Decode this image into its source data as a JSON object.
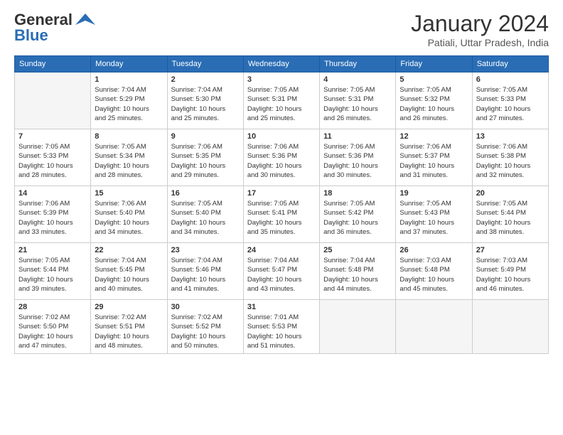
{
  "header": {
    "logo_general": "General",
    "logo_blue": "Blue",
    "month_title": "January 2024",
    "location": "Patiali, Uttar Pradesh, India"
  },
  "days_of_week": [
    "Sunday",
    "Monday",
    "Tuesday",
    "Wednesday",
    "Thursday",
    "Friday",
    "Saturday"
  ],
  "weeks": [
    [
      {
        "day": "",
        "empty": true
      },
      {
        "day": "1",
        "sunrise": "7:04 AM",
        "sunset": "5:29 PM",
        "daylight": "10 hours and 25 minutes."
      },
      {
        "day": "2",
        "sunrise": "7:04 AM",
        "sunset": "5:30 PM",
        "daylight": "10 hours and 25 minutes."
      },
      {
        "day": "3",
        "sunrise": "7:05 AM",
        "sunset": "5:31 PM",
        "daylight": "10 hours and 25 minutes."
      },
      {
        "day": "4",
        "sunrise": "7:05 AM",
        "sunset": "5:31 PM",
        "daylight": "10 hours and 26 minutes."
      },
      {
        "day": "5",
        "sunrise": "7:05 AM",
        "sunset": "5:32 PM",
        "daylight": "10 hours and 26 minutes."
      },
      {
        "day": "6",
        "sunrise": "7:05 AM",
        "sunset": "5:33 PM",
        "daylight": "10 hours and 27 minutes."
      }
    ],
    [
      {
        "day": "7",
        "sunrise": "7:05 AM",
        "sunset": "5:33 PM",
        "daylight": "10 hours and 28 minutes."
      },
      {
        "day": "8",
        "sunrise": "7:05 AM",
        "sunset": "5:34 PM",
        "daylight": "10 hours and 28 minutes."
      },
      {
        "day": "9",
        "sunrise": "7:06 AM",
        "sunset": "5:35 PM",
        "daylight": "10 hours and 29 minutes."
      },
      {
        "day": "10",
        "sunrise": "7:06 AM",
        "sunset": "5:36 PM",
        "daylight": "10 hours and 30 minutes."
      },
      {
        "day": "11",
        "sunrise": "7:06 AM",
        "sunset": "5:36 PM",
        "daylight": "10 hours and 30 minutes."
      },
      {
        "day": "12",
        "sunrise": "7:06 AM",
        "sunset": "5:37 PM",
        "daylight": "10 hours and 31 minutes."
      },
      {
        "day": "13",
        "sunrise": "7:06 AM",
        "sunset": "5:38 PM",
        "daylight": "10 hours and 32 minutes."
      }
    ],
    [
      {
        "day": "14",
        "sunrise": "7:06 AM",
        "sunset": "5:39 PM",
        "daylight": "10 hours and 33 minutes."
      },
      {
        "day": "15",
        "sunrise": "7:06 AM",
        "sunset": "5:40 PM",
        "daylight": "10 hours and 34 minutes."
      },
      {
        "day": "16",
        "sunrise": "7:05 AM",
        "sunset": "5:40 PM",
        "daylight": "10 hours and 34 minutes."
      },
      {
        "day": "17",
        "sunrise": "7:05 AM",
        "sunset": "5:41 PM",
        "daylight": "10 hours and 35 minutes."
      },
      {
        "day": "18",
        "sunrise": "7:05 AM",
        "sunset": "5:42 PM",
        "daylight": "10 hours and 36 minutes."
      },
      {
        "day": "19",
        "sunrise": "7:05 AM",
        "sunset": "5:43 PM",
        "daylight": "10 hours and 37 minutes."
      },
      {
        "day": "20",
        "sunrise": "7:05 AM",
        "sunset": "5:44 PM",
        "daylight": "10 hours and 38 minutes."
      }
    ],
    [
      {
        "day": "21",
        "sunrise": "7:05 AM",
        "sunset": "5:44 PM",
        "daylight": "10 hours and 39 minutes."
      },
      {
        "day": "22",
        "sunrise": "7:04 AM",
        "sunset": "5:45 PM",
        "daylight": "10 hours and 40 minutes."
      },
      {
        "day": "23",
        "sunrise": "7:04 AM",
        "sunset": "5:46 PM",
        "daylight": "10 hours and 41 minutes."
      },
      {
        "day": "24",
        "sunrise": "7:04 AM",
        "sunset": "5:47 PM",
        "daylight": "10 hours and 43 minutes."
      },
      {
        "day": "25",
        "sunrise": "7:04 AM",
        "sunset": "5:48 PM",
        "daylight": "10 hours and 44 minutes."
      },
      {
        "day": "26",
        "sunrise": "7:03 AM",
        "sunset": "5:48 PM",
        "daylight": "10 hours and 45 minutes."
      },
      {
        "day": "27",
        "sunrise": "7:03 AM",
        "sunset": "5:49 PM",
        "daylight": "10 hours and 46 minutes."
      }
    ],
    [
      {
        "day": "28",
        "sunrise": "7:02 AM",
        "sunset": "5:50 PM",
        "daylight": "10 hours and 47 minutes."
      },
      {
        "day": "29",
        "sunrise": "7:02 AM",
        "sunset": "5:51 PM",
        "daylight": "10 hours and 48 minutes."
      },
      {
        "day": "30",
        "sunrise": "7:02 AM",
        "sunset": "5:52 PM",
        "daylight": "10 hours and 50 minutes."
      },
      {
        "day": "31",
        "sunrise": "7:01 AM",
        "sunset": "5:53 PM",
        "daylight": "10 hours and 51 minutes."
      },
      {
        "day": "",
        "empty": true
      },
      {
        "day": "",
        "empty": true
      },
      {
        "day": "",
        "empty": true
      }
    ]
  ]
}
